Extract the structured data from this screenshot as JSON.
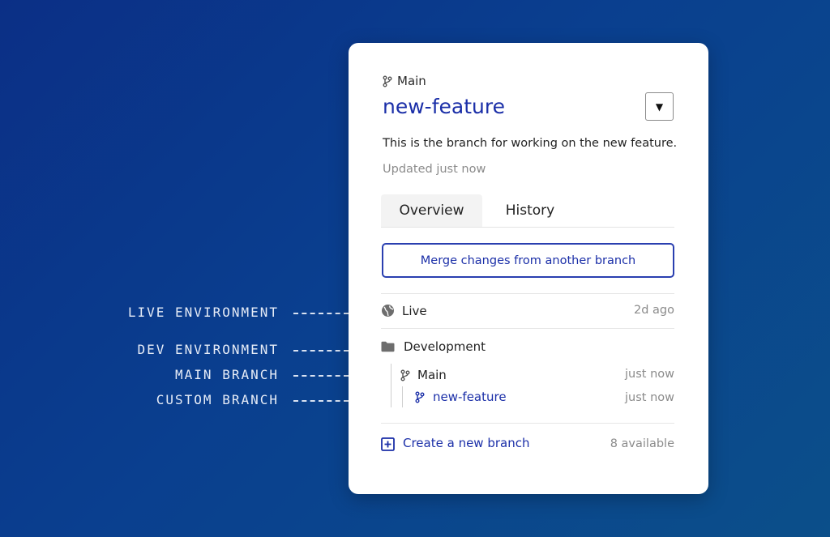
{
  "labels": {
    "live_env": "LIVE ENVIRONMENT",
    "dev_env": "DEV ENVIRONMENT",
    "main_branch": "MAIN BRANCH",
    "custom_branch": "CUSTOM BRANCH"
  },
  "card": {
    "breadcrumb": "Main",
    "title": "new-feature",
    "dropdown_icon": "▼",
    "description": "This is the branch for working on the new feature.",
    "updated": "Updated just now",
    "tabs": [
      {
        "label": "Overview",
        "active": true
      },
      {
        "label": "History",
        "active": false
      }
    ],
    "merge_button": "Merge changes from another branch",
    "environments": {
      "live": {
        "label": "Live",
        "time": "2d ago",
        "icon": "globe-icon"
      },
      "development": {
        "label": "Development",
        "icon": "folder-icon"
      }
    },
    "branches": [
      {
        "label": "Main",
        "time": "just now",
        "icon": "branch-icon"
      },
      {
        "label": "new-feature",
        "time": "just now",
        "icon": "branch-icon"
      }
    ],
    "create_branch": {
      "label": "Create a new branch",
      "available": "8 available",
      "icon": "plus-square-icon"
    }
  },
  "colors": {
    "accent": "#1b2fa8",
    "background": "#0a3f8f",
    "muted_text": "#8b8b8b"
  }
}
